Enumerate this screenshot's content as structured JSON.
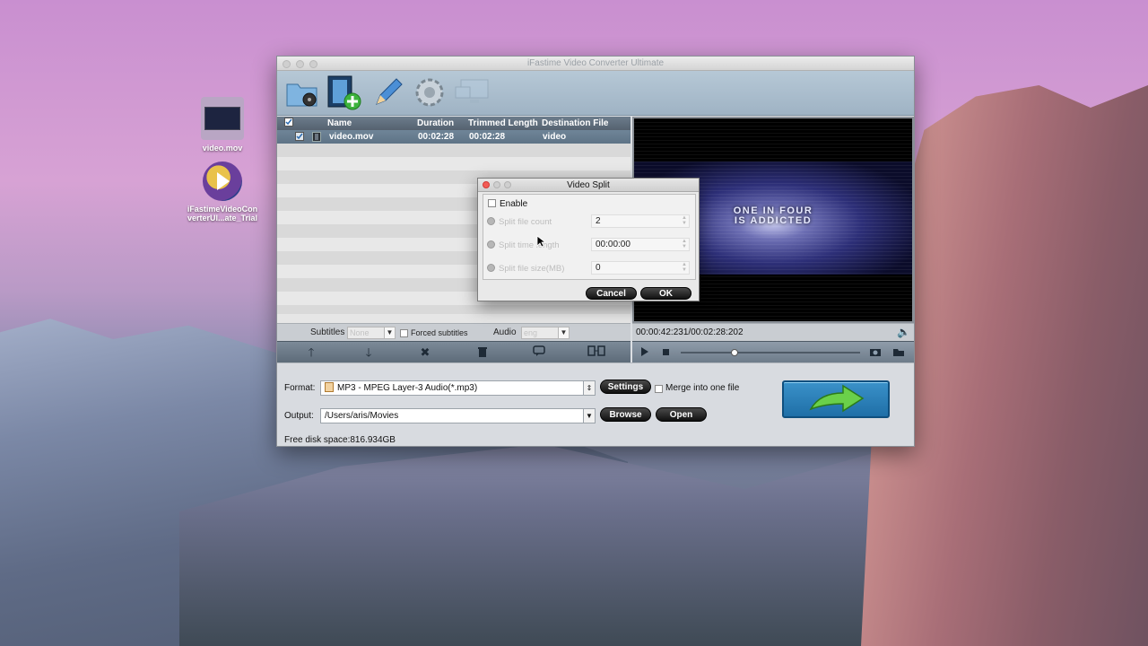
{
  "desktop": {
    "icons": [
      {
        "label": "video.mov"
      },
      {
        "label_line1": "iFastimeVideoCon",
        "label_line2": "verterUl...ate_Trial"
      }
    ]
  },
  "window": {
    "title": "iFastime Video Converter Ultimate",
    "toolbar": {
      "add_folder": "add-folder-icon",
      "add_video": "add-video-icon",
      "edit": "edit-pencil-icon",
      "settings": "settings-gear-icon",
      "display": "display-monitor-icon"
    },
    "filelist": {
      "columns": [
        "Name",
        "Duration",
        "Trimmed Length",
        "Destination File"
      ],
      "rows": [
        {
          "name": "video.mov",
          "duration": "00:02:28",
          "trimmed": "00:02:28",
          "destination": "video"
        }
      ],
      "subtitles_label": "Subtitles",
      "subtitles_value": "None",
      "forced_subtitles_label": "Forced subtitles",
      "audio_label": "Audio",
      "audio_value": "eng"
    },
    "preview": {
      "overlay_line1": "ONE IN FOUR",
      "overlay_line2": "IS ADDICTED",
      "timecode": "00:00:42:231/00:02:28:202"
    },
    "bottom": {
      "format_label": "Format:",
      "format_value": "MP3 - MPEG Layer-3 Audio(*.mp3)",
      "settings_button": "Settings",
      "merge_label": "Merge into one file",
      "output_label": "Output:",
      "output_value": "/Users/aris/Movies",
      "browse_button": "Browse",
      "open_button": "Open",
      "disk_space": "Free disk space:816.934GB"
    }
  },
  "dialog": {
    "title": "Video Split",
    "enable_label": "Enable",
    "options": [
      {
        "label": "Split file count",
        "value": "2"
      },
      {
        "label": "Split time length",
        "value": "00:00:00"
      },
      {
        "label": "Split file size(MB)",
        "value": "0"
      }
    ],
    "cancel_button": "Cancel",
    "ok_button": "OK"
  },
  "colors": {
    "accent_row": "#5e7386",
    "convert_button": "#1f6fa7",
    "close_red": "#f25b55"
  }
}
